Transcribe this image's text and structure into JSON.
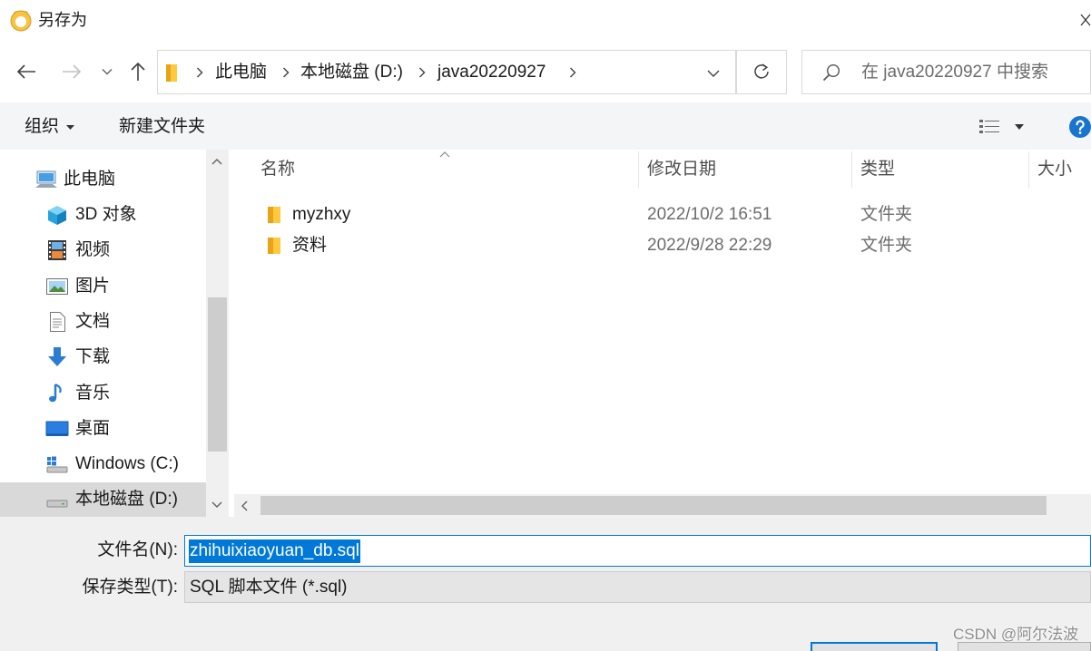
{
  "window": {
    "title": "另存为"
  },
  "address": {
    "crumbs": [
      "此电脑",
      "本地磁盘 (D:)",
      "java20220927"
    ],
    "icon": "folder-icon"
  },
  "search": {
    "placeholder": "在 java20220927 中搜索",
    "icon": "search-icon"
  },
  "toolbar": {
    "organize": "组织",
    "new_folder": "新建文件夹"
  },
  "columns": {
    "name": "名称",
    "modified": "修改日期",
    "type": "类型",
    "size": "大小"
  },
  "files": [
    {
      "name": "myzhxy",
      "modified": "2022/10/2 16:51",
      "type": "文件夹",
      "icon": "folder-icon"
    },
    {
      "name": "资料",
      "modified": "2022/9/28 22:29",
      "type": "文件夹",
      "icon": "folder-icon"
    }
  ],
  "sidebar": {
    "selected_index": 9,
    "items": [
      {
        "label": "此电脑",
        "icon": "computer-icon"
      },
      {
        "label": "3D 对象",
        "icon": "cube-3d-icon"
      },
      {
        "label": "视频",
        "icon": "video-icon"
      },
      {
        "label": "图片",
        "icon": "picture-icon"
      },
      {
        "label": "文档",
        "icon": "document-icon"
      },
      {
        "label": "下载",
        "icon": "download-icon"
      },
      {
        "label": "音乐",
        "icon": "music-icon"
      },
      {
        "label": "桌面",
        "icon": "desktop-icon"
      },
      {
        "label": "Windows (C:)",
        "icon": "windows-drive-icon"
      },
      {
        "label": "本地磁盘 (D:)",
        "icon": "drive-icon"
      }
    ]
  },
  "filename": {
    "label": "文件名(N):",
    "value": "zhihuixiaoyuan_db.sql"
  },
  "filetype": {
    "label": "保存类型(T):",
    "value": "SQL 脚本文件 (*.sql)"
  },
  "watermark": "CSDN @阿尔法波",
  "colors": {
    "accent": "#0078d7",
    "folder": "#ffc83d",
    "selection": "#d9d9d9",
    "help": "#1874cd"
  }
}
